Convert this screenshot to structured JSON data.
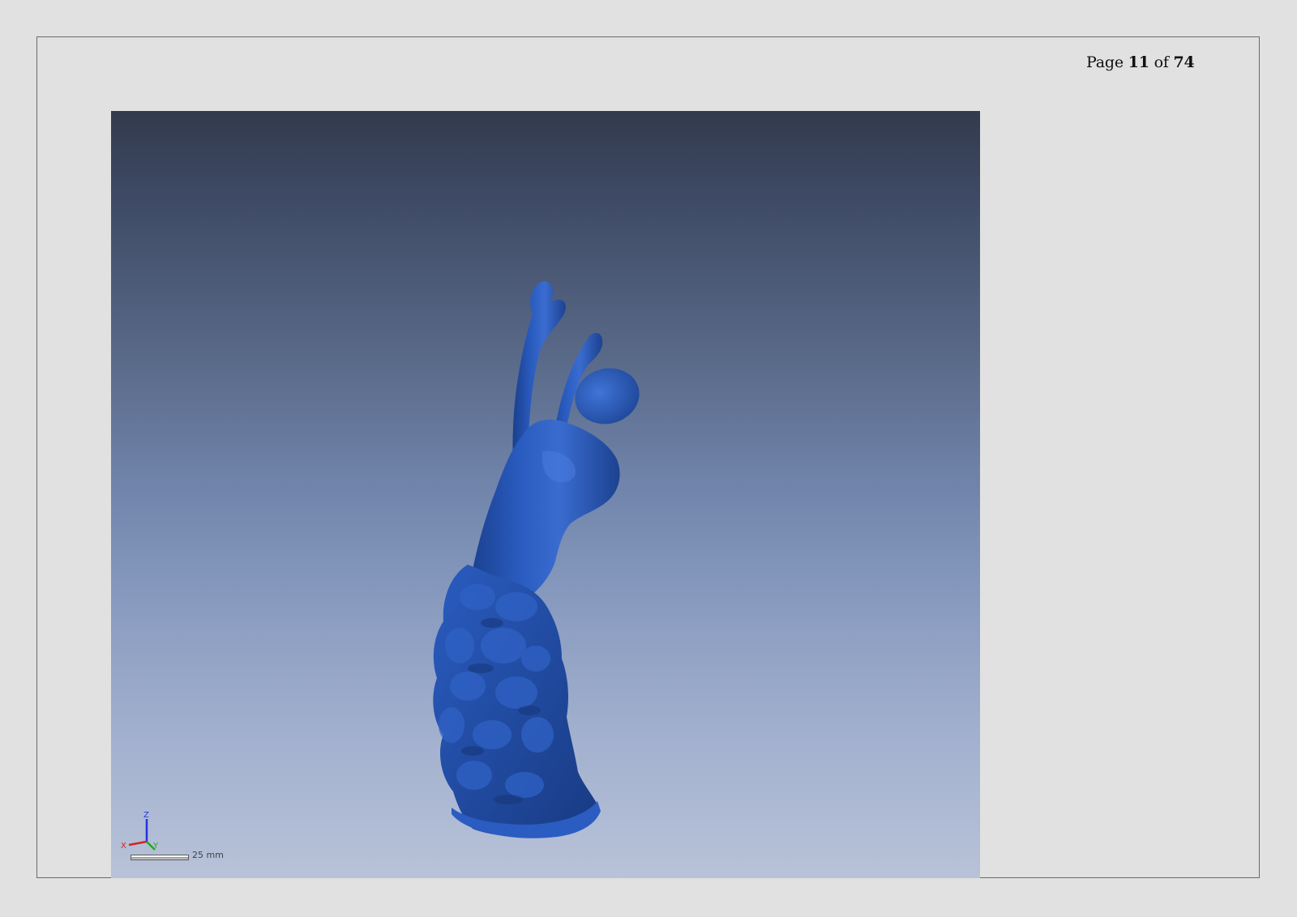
{
  "header": {
    "page_prefix": "Page",
    "current_page": "11",
    "of_label": "of",
    "total_pages": "74"
  },
  "viewport": {
    "model_color": "#2456b3",
    "background_top": "#323a4d",
    "background_bottom": "#b8c2d8",
    "axis_labels": {
      "x": "X",
      "y": "Y",
      "z": "Z"
    },
    "axis_colors": {
      "x": "#d42222",
      "y": "#22aa22",
      "z": "#2233dd"
    },
    "scale_label": "25 mm"
  }
}
